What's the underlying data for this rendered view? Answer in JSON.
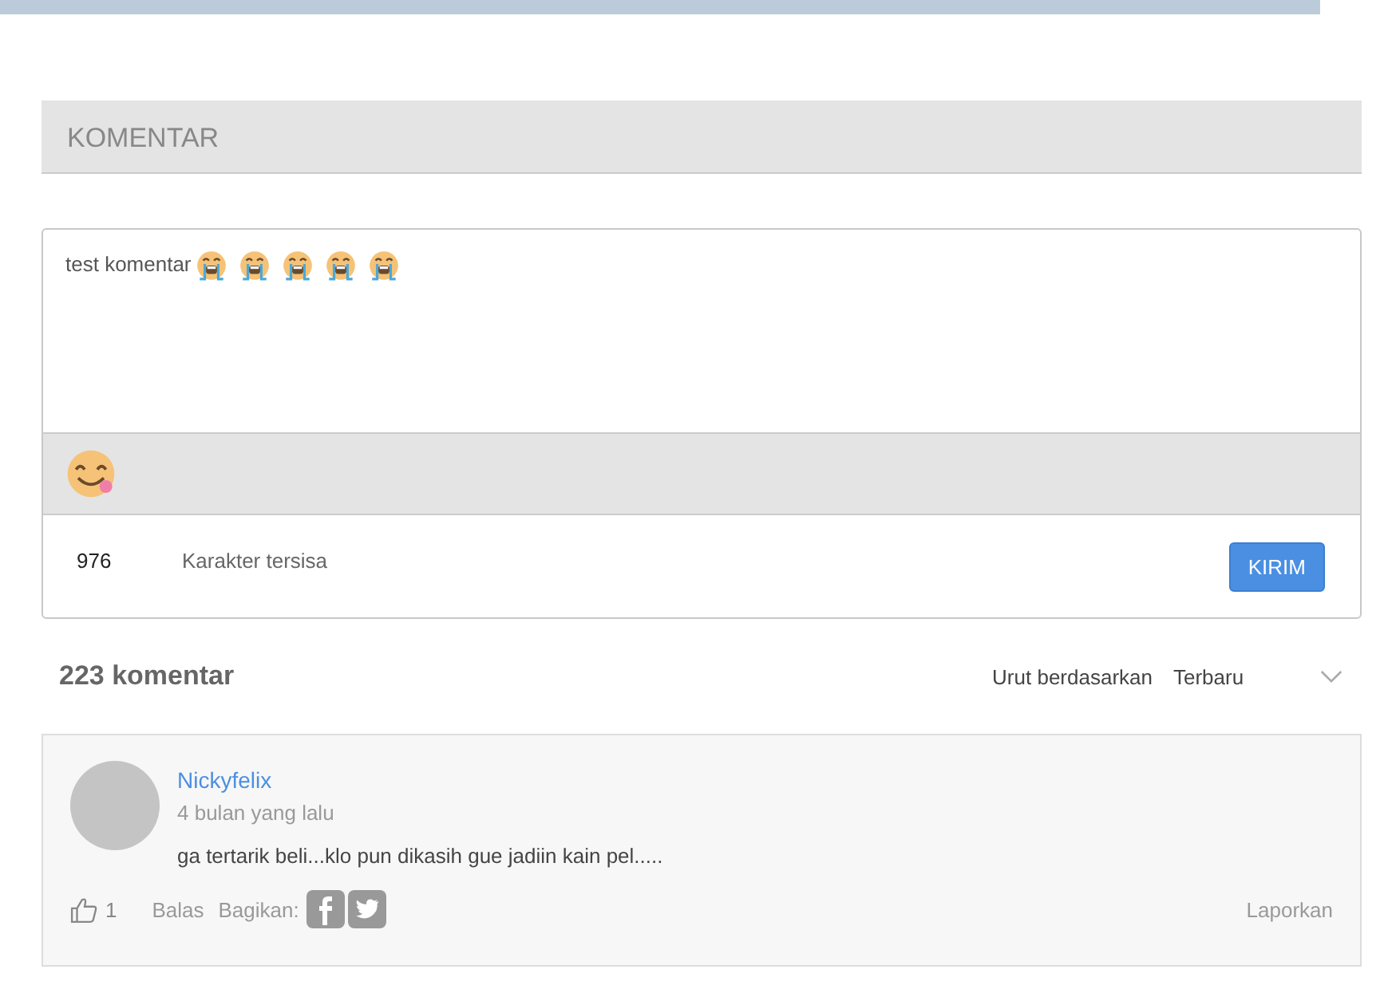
{
  "section": {
    "title": "KOMENTAR"
  },
  "editor": {
    "value": "test komentar",
    "emojis": [
      {
        "kind": "crying"
      },
      {
        "kind": "crying"
      },
      {
        "kind": "crying"
      },
      {
        "kind": "crying"
      },
      {
        "kind": "crying"
      }
    ],
    "remaining": "976",
    "remaining_label": "Karakter tersisa",
    "submit": "KIRIM"
  },
  "comments_header": {
    "count": "223 komentar",
    "sort_label": "Urut berdasarkan",
    "sort_value": "Terbaru"
  },
  "comments": [
    {
      "author": "Nickyfelix",
      "time": "4 bulan yang lalu",
      "text": "ga tertarik beli...klo pun dikasih gue jadiin kain pel.....",
      "likes": "1",
      "reply": "Balas",
      "share_label": "Bagikan:",
      "report": "Laporkan"
    }
  ]
}
